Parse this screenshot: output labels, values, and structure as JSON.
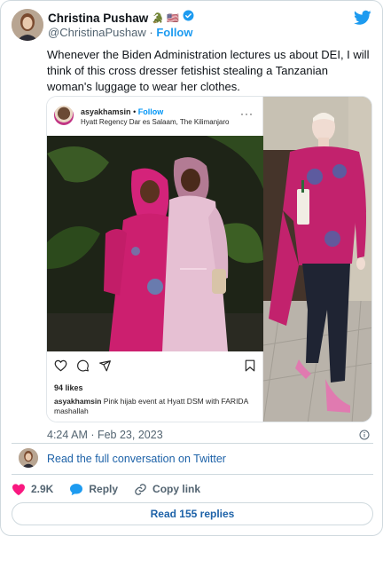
{
  "tweet": {
    "author": {
      "name": "Christina Pushaw",
      "handle": "@ChristinaPushaw",
      "emoji": "🐊 🇺🇸"
    },
    "follow_label": "Follow",
    "text": "Whenever the Biden Administration lectures us about DEI, I will think of this cross dresser fetishist stealing a Tanzanian woman's luggage to wear her clothes.",
    "timestamp": "4:24 AM · Feb 23, 2023",
    "read_conversation": "Read the full conversation on Twitter",
    "likes": "2.9K",
    "reply_label": "Reply",
    "copy_link_label": "Copy link",
    "read_replies": "Read 155 replies"
  },
  "instagram": {
    "username": "asyakhamsin",
    "follow_label": "Follow",
    "location": "Hyatt Regency Dar es Salaam, The Kilimanjaro",
    "likes": "94 likes",
    "caption_user": "asyakhamsin",
    "caption_text": "Pink hijab event at Hyatt DSM with FARIDA mashallah"
  },
  "colors": {
    "brand": "#1d9bf0",
    "like": "#f91880",
    "link": "#1d62a8",
    "text": "#0f1419",
    "muted": "#536471"
  },
  "icons": [
    "verified-badge-icon",
    "twitter-bird-icon",
    "info-icon",
    "heart-icon",
    "reply-bubble-icon",
    "link-icon",
    "instagram-heart-icon",
    "instagram-comment-icon",
    "instagram-share-icon",
    "instagram-bookmark-icon"
  ]
}
